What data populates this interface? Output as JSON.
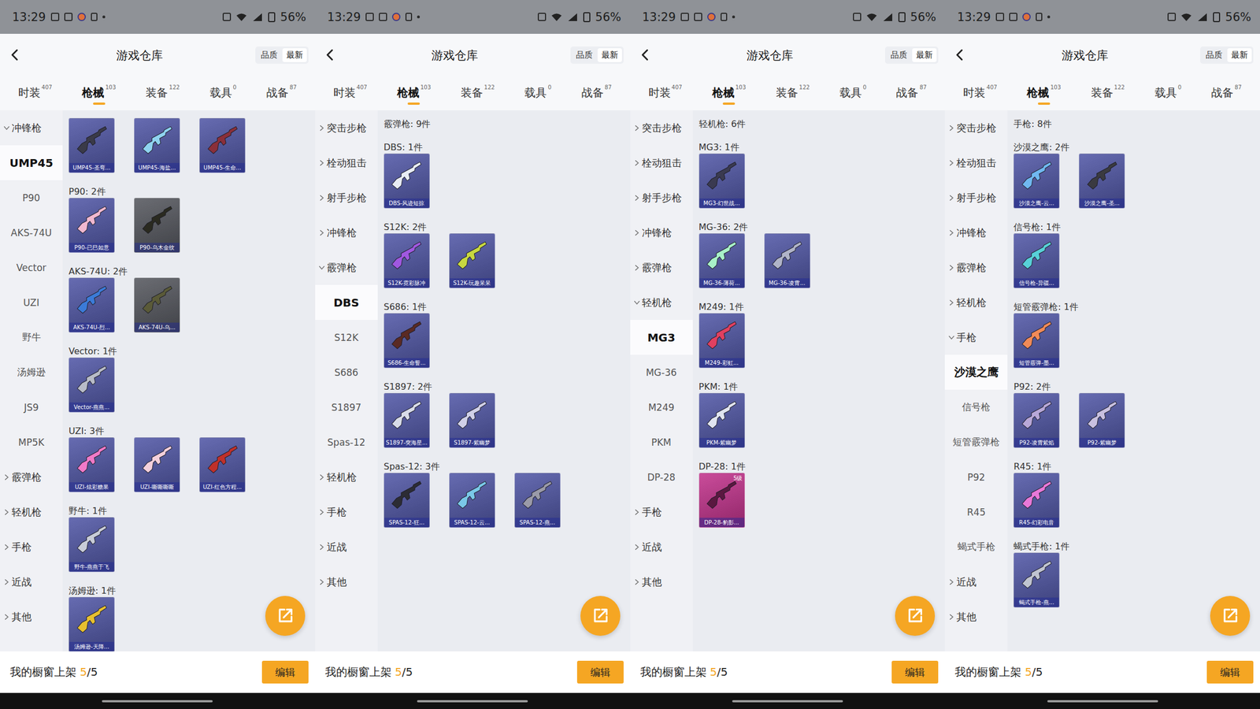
{
  "screens": [
    {
      "status": {
        "time": "13:29",
        "battery": "56%"
      },
      "header": {
        "title": "游戏仓库",
        "sort": [
          {
            "label": "品质",
            "selected": false
          },
          {
            "label": "最新",
            "selected": true
          }
        ]
      },
      "tabs": [
        {
          "label": "时装",
          "count": "407",
          "selected": false
        },
        {
          "label": "枪械",
          "count": "103",
          "selected": true
        },
        {
          "label": "装备",
          "count": "122",
          "selected": false
        },
        {
          "label": "载具",
          "count": "0",
          "selected": false
        },
        {
          "label": "战备",
          "count": "87",
          "selected": false
        }
      ],
      "sidebar": [
        {
          "label": "冲锋枪",
          "kind": "category",
          "expanded": true,
          "selected": false
        },
        {
          "label": "UMP45",
          "kind": "sub",
          "expanded": false,
          "selected": true
        },
        {
          "label": "P90",
          "kind": "sub",
          "expanded": false,
          "selected": false
        },
        {
          "label": "AKS-74U",
          "kind": "sub",
          "expanded": false,
          "selected": false
        },
        {
          "label": "Vector",
          "kind": "sub",
          "expanded": false,
          "selected": false
        },
        {
          "label": "UZI",
          "kind": "sub",
          "expanded": false,
          "selected": false
        },
        {
          "label": "野牛",
          "kind": "sub",
          "expanded": false,
          "selected": false
        },
        {
          "label": "汤姆逊",
          "kind": "sub",
          "expanded": false,
          "selected": false
        },
        {
          "label": "JS9",
          "kind": "sub",
          "expanded": false,
          "selected": false
        },
        {
          "label": "MP5K",
          "kind": "sub",
          "expanded": false,
          "selected": false
        },
        {
          "label": "霰弹枪",
          "kind": "category",
          "expanded": false,
          "selected": false
        },
        {
          "label": "轻机枪",
          "kind": "category",
          "expanded": false,
          "selected": false
        },
        {
          "label": "手枪",
          "kind": "category",
          "expanded": false,
          "selected": false
        },
        {
          "label": "近战",
          "kind": "category",
          "expanded": false,
          "selected": false
        },
        {
          "label": "其他",
          "kind": "category",
          "expanded": false,
          "selected": false
        }
      ],
      "content": {
        "summary": "",
        "groups": [
          {
            "title": "",
            "items": [
              {
                "name": "UMP45-圣弯...",
                "color": "#5157a6",
                "gun": "#3a3a48"
              },
              {
                "name": "UMP45-海盐...",
                "color": "#5157a6",
                "gun": "#8fd3f0"
              },
              {
                "name": "UMP45-生命...",
                "color": "#5157a6",
                "gun": "#8a2f3a"
              }
            ]
          },
          {
            "title": "P90: 2件",
            "items": [
              {
                "name": "P90-已巳如意",
                "color": "#5157a6",
                "gun": "#f0b8d0"
              },
              {
                "name": "P90-乌木金纹",
                "color": "#56585f",
                "gun": "#2a2a20"
              }
            ]
          },
          {
            "title": "AKS-74U: 2件",
            "items": [
              {
                "name": "AKS-74U-烈...",
                "color": "#5157a6",
                "gun": "#3b7bd8"
              },
              {
                "name": "AKS-74U-乌...",
                "color": "#56585f",
                "gun": "#5a5a38"
              }
            ]
          },
          {
            "title": "Vector: 1件",
            "items": [
              {
                "name": "Vector-燕燕...",
                "color": "#5157a6",
                "gun": "#b8bcc8"
              }
            ]
          },
          {
            "title": "UZI: 3件",
            "items": [
              {
                "name": "UZI-炫彩糖果",
                "color": "#5157a6",
                "gun": "#f07ac8"
              },
              {
                "name": "UZI-嘶嘶嘶嘶",
                "color": "#5157a6",
                "gun": "#f4d0dc"
              },
              {
                "name": "UZI-红色方程...",
                "color": "#5157a6",
                "gun": "#c0302a"
              }
            ]
          },
          {
            "title": "野牛: 1件",
            "items": [
              {
                "name": "野牛-燕燕于飞",
                "color": "#5157a6",
                "gun": "#c8ccd8"
              }
            ]
          },
          {
            "title": "汤姆逊: 1件",
            "items": [
              {
                "name": "汤姆逊-天降...",
                "color": "#5157a6",
                "gun": "#e8c030"
              }
            ]
          }
        ]
      },
      "showcase": {
        "label": "我的橱窗上架",
        "count": "5",
        "total": "/5",
        "button": "编辑"
      }
    },
    {
      "status": {
        "time": "13:29",
        "battery": "56%"
      },
      "header": {
        "title": "游戏仓库",
        "sort": [
          {
            "label": "品质",
            "selected": false
          },
          {
            "label": "最新",
            "selected": true
          }
        ]
      },
      "tabs": [
        {
          "label": "时装",
          "count": "407",
          "selected": false
        },
        {
          "label": "枪械",
          "count": "103",
          "selected": true
        },
        {
          "label": "装备",
          "count": "122",
          "selected": false
        },
        {
          "label": "载具",
          "count": "0",
          "selected": false
        },
        {
          "label": "战备",
          "count": "87",
          "selected": false
        }
      ],
      "sidebar": [
        {
          "label": "突击步枪",
          "kind": "category",
          "expanded": false,
          "selected": false
        },
        {
          "label": "栓动狙击",
          "kind": "category",
          "expanded": false,
          "selected": false
        },
        {
          "label": "射手步枪",
          "kind": "category",
          "expanded": false,
          "selected": false
        },
        {
          "label": "冲锋枪",
          "kind": "category",
          "expanded": false,
          "selected": false
        },
        {
          "label": "霰弹枪",
          "kind": "category",
          "expanded": true,
          "selected": false
        },
        {
          "label": "DBS",
          "kind": "sub",
          "expanded": false,
          "selected": true
        },
        {
          "label": "S12K",
          "kind": "sub",
          "expanded": false,
          "selected": false
        },
        {
          "label": "S686",
          "kind": "sub",
          "expanded": false,
          "selected": false
        },
        {
          "label": "S1897",
          "kind": "sub",
          "expanded": false,
          "selected": false
        },
        {
          "label": "Spas-12",
          "kind": "sub",
          "expanded": false,
          "selected": false
        },
        {
          "label": "轻机枪",
          "kind": "category",
          "expanded": false,
          "selected": false
        },
        {
          "label": "手枪",
          "kind": "category",
          "expanded": false,
          "selected": false
        },
        {
          "label": "近战",
          "kind": "category",
          "expanded": false,
          "selected": false
        },
        {
          "label": "其他",
          "kind": "category",
          "expanded": false,
          "selected": false
        }
      ],
      "content": {
        "summary": "霰弹枪: 9件",
        "groups": [
          {
            "title": "DBS: 1件",
            "items": [
              {
                "name": "DBS-风迹短掠",
                "color": "#5157a6",
                "gun": "#e8ecf4"
              }
            ]
          },
          {
            "title": "S12K: 2件",
            "items": [
              {
                "name": "S12K-霓彩脉冲",
                "color": "#5157a6",
                "gun": "#a058e0"
              },
              {
                "name": "S12K-玩趣呆呆",
                "color": "#5157a6",
                "gun": "#c8d840"
              }
            ]
          },
          {
            "title": "S686: 1件",
            "items": [
              {
                "name": "S686-生命誓...",
                "color": "#5157a6",
                "gun": "#5a2a24"
              }
            ]
          },
          {
            "title": "S1897: 2件",
            "items": [
              {
                "name": "S1897-突海星...",
                "color": "#5157a6",
                "gun": "#d8dce8"
              },
              {
                "name": "S1897-紫幽梦",
                "color": "#5157a6",
                "gun": "#d0d0e8"
              }
            ]
          },
          {
            "title": "Spas-12: 3件",
            "items": [
              {
                "name": "SPAS-12-狂...",
                "color": "#5157a6",
                "gun": "#2c2c34"
              },
              {
                "name": "SPAS-12-云...",
                "color": "#5157a6",
                "gun": "#7ac8e8"
              },
              {
                "name": "SPAS-12-燕...",
                "color": "#5157a6",
                "gun": "#9a9aa8"
              }
            ]
          }
        ]
      },
      "showcase": {
        "label": "我的橱窗上架",
        "count": "5",
        "total": "/5",
        "button": "编辑"
      }
    },
    {
      "status": {
        "time": "13:29",
        "battery": "56%"
      },
      "header": {
        "title": "游戏仓库",
        "sort": [
          {
            "label": "品质",
            "selected": false
          },
          {
            "label": "最新",
            "selected": true
          }
        ]
      },
      "tabs": [
        {
          "label": "时装",
          "count": "407",
          "selected": false
        },
        {
          "label": "枪械",
          "count": "103",
          "selected": true
        },
        {
          "label": "装备",
          "count": "122",
          "selected": false
        },
        {
          "label": "载具",
          "count": "0",
          "selected": false
        },
        {
          "label": "战备",
          "count": "87",
          "selected": false
        }
      ],
      "sidebar": [
        {
          "label": "突击步枪",
          "kind": "category",
          "expanded": false,
          "selected": false
        },
        {
          "label": "栓动狙击",
          "kind": "category",
          "expanded": false,
          "selected": false
        },
        {
          "label": "射手步枪",
          "kind": "category",
          "expanded": false,
          "selected": false
        },
        {
          "label": "冲锋枪",
          "kind": "category",
          "expanded": false,
          "selected": false
        },
        {
          "label": "霰弹枪",
          "kind": "category",
          "expanded": false,
          "selected": false
        },
        {
          "label": "轻机枪",
          "kind": "category",
          "expanded": true,
          "selected": false
        },
        {
          "label": "MG3",
          "kind": "sub",
          "expanded": false,
          "selected": true
        },
        {
          "label": "MG-36",
          "kind": "sub",
          "expanded": false,
          "selected": false
        },
        {
          "label": "M249",
          "kind": "sub",
          "expanded": false,
          "selected": false
        },
        {
          "label": "PKM",
          "kind": "sub",
          "expanded": false,
          "selected": false
        },
        {
          "label": "DP-28",
          "kind": "sub",
          "expanded": false,
          "selected": false
        },
        {
          "label": "手枪",
          "kind": "category",
          "expanded": false,
          "selected": false
        },
        {
          "label": "近战",
          "kind": "category",
          "expanded": false,
          "selected": false
        },
        {
          "label": "其他",
          "kind": "category",
          "expanded": false,
          "selected": false
        }
      ],
      "content": {
        "summary": "轻机枪: 6件",
        "groups": [
          {
            "title": "MG3: 1件",
            "items": [
              {
                "name": "MG3-幻世战...",
                "color": "#5157a6",
                "gun": "#3a3a50"
              }
            ]
          },
          {
            "title": "MG-36: 2件",
            "items": [
              {
                "name": "MG-36-薄荷...",
                "color": "#5157a6",
                "gun": "#a8f0c8"
              },
              {
                "name": "MG-36-凌霄...",
                "color": "#5157a6",
                "gun": "#b0b4c8"
              }
            ]
          },
          {
            "title": "M249: 1件",
            "items": [
              {
                "name": "M249-彩虹...",
                "color": "#5157a6",
                "gun": "#e04060"
              }
            ]
          },
          {
            "title": "PKM: 1件",
            "items": [
              {
                "name": "PKM-紫幽梦",
                "color": "#5157a6",
                "gun": "#e0e4f0"
              }
            ]
          },
          {
            "title": "DP-28: 1件",
            "items": [
              {
                "name": "DP-28-豹影...",
                "color": "#c2338c",
                "gun": "#5a1840",
                "badge": "5级"
              }
            ]
          }
        ]
      },
      "showcase": {
        "label": "我的橱窗上架",
        "count": "5",
        "total": "/5",
        "button": "编辑"
      }
    },
    {
      "status": {
        "time": "13:29",
        "battery": "56%"
      },
      "header": {
        "title": "游戏仓库",
        "sort": [
          {
            "label": "品质",
            "selected": false
          },
          {
            "label": "最新",
            "selected": true
          }
        ]
      },
      "tabs": [
        {
          "label": "时装",
          "count": "407",
          "selected": false
        },
        {
          "label": "枪械",
          "count": "103",
          "selected": true
        },
        {
          "label": "装备",
          "count": "122",
          "selected": false
        },
        {
          "label": "载具",
          "count": "0",
          "selected": false
        },
        {
          "label": "战备",
          "count": "87",
          "selected": false
        }
      ],
      "sidebar": [
        {
          "label": "突击步枪",
          "kind": "category",
          "expanded": false,
          "selected": false
        },
        {
          "label": "栓动狙击",
          "kind": "category",
          "expanded": false,
          "selected": false
        },
        {
          "label": "射手步枪",
          "kind": "category",
          "expanded": false,
          "selected": false
        },
        {
          "label": "冲锋枪",
          "kind": "category",
          "expanded": false,
          "selected": false
        },
        {
          "label": "霰弹枪",
          "kind": "category",
          "expanded": false,
          "selected": false
        },
        {
          "label": "轻机枪",
          "kind": "category",
          "expanded": false,
          "selected": false
        },
        {
          "label": "手枪",
          "kind": "category",
          "expanded": true,
          "selected": false
        },
        {
          "label": "沙漠之鹰",
          "kind": "sub",
          "expanded": false,
          "selected": true
        },
        {
          "label": "信号枪",
          "kind": "sub",
          "expanded": false,
          "selected": false
        },
        {
          "label": "短管霰弹枪",
          "kind": "sub",
          "expanded": false,
          "selected": false
        },
        {
          "label": "P92",
          "kind": "sub",
          "expanded": false,
          "selected": false
        },
        {
          "label": "R45",
          "kind": "sub",
          "expanded": false,
          "selected": false
        },
        {
          "label": "蝎式手枪",
          "kind": "sub",
          "expanded": false,
          "selected": false
        },
        {
          "label": "近战",
          "kind": "category",
          "expanded": false,
          "selected": false
        },
        {
          "label": "其他",
          "kind": "category",
          "expanded": false,
          "selected": false
        }
      ],
      "content": {
        "summary": "手枪: 8件",
        "groups": [
          {
            "title": "沙漠之鹰: 2件",
            "items": [
              {
                "name": "沙漠之鹰-云...",
                "color": "#5157a6",
                "gun": "#70b8f0"
              },
              {
                "name": "沙漠之鹰-圣...",
                "color": "#5157a6",
                "gun": "#3a3a40"
              }
            ]
          },
          {
            "title": "信号枪: 1件",
            "items": [
              {
                "name": "信号枪-异疆...",
                "color": "#5157a6",
                "gun": "#58d0d8"
              }
            ]
          },
          {
            "title": "短管霰弹枪: 1件",
            "items": [
              {
                "name": "短管霰弹-墨...",
                "color": "#5157a6",
                "gun": "#f08a58"
              }
            ]
          },
          {
            "title": "P92: 2件",
            "items": [
              {
                "name": "P92-凌霄紫焰",
                "color": "#5157a6",
                "gun": "#b8a8d8"
              },
              {
                "name": "P92-紫幽梦",
                "color": "#5157a6",
                "gun": "#c8c0e0"
              }
            ]
          },
          {
            "title": "R45: 1件",
            "items": [
              {
                "name": "R45-幻彩电音",
                "color": "#5157a6",
                "gun": "#e878d8"
              }
            ]
          },
          {
            "title": "蝎式手枪: 1件",
            "items": [
              {
                "name": "蝎式手枪-燕...",
                "color": "#5157a6",
                "gun": "#c0c4d0"
              }
            ]
          }
        ]
      },
      "showcase": {
        "label": "我的橱窗上架",
        "count": "5",
        "total": "/5",
        "button": "编辑"
      }
    }
  ]
}
